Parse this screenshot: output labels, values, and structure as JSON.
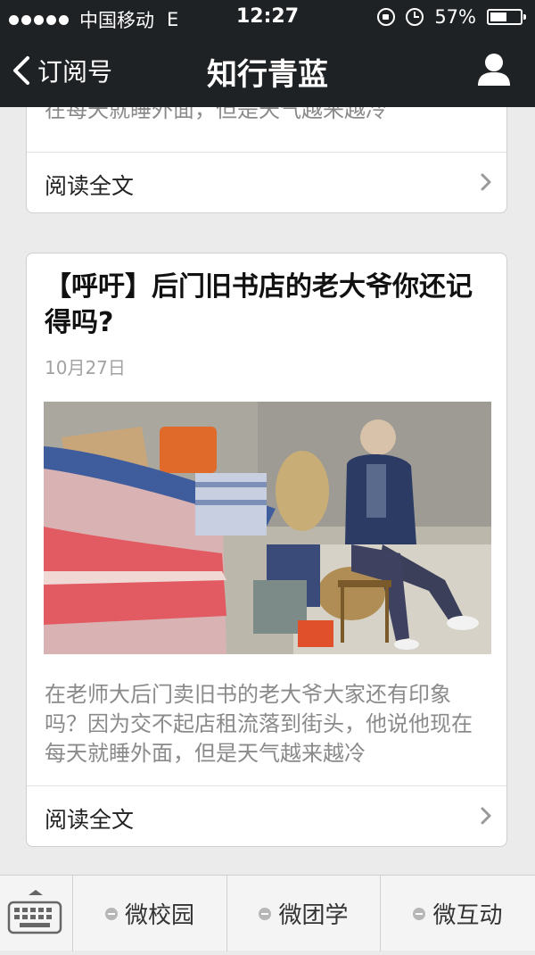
{
  "status": {
    "carrier": "中国移动",
    "network": "E",
    "time": "12:27",
    "battery": "57%",
    "battery_level": 0.57
  },
  "nav": {
    "back_label": "订阅号",
    "title": "知行青蓝"
  },
  "articles": [
    {
      "snippet_tail": "在每天就睡外面，但是天气越来越冷",
      "read_more": "阅读全文"
    },
    {
      "title": "【呼吁】后门旧书店的老大爷你还记得吗?",
      "date": "10月27日",
      "snippet": "在老师大后门卖旧书的老大爷大家还有印象吗？因为交不起店租流落到街头，他说他现在每天就睡外面，但是天气越来越冷",
      "read_more": "阅读全文"
    }
  ],
  "bottom_menu": {
    "items": [
      "微校园",
      "微团学",
      "微互动"
    ]
  },
  "colors": {
    "bar": "#1f2224",
    "background": "#ebebeb",
    "snippet": "#8a8a8a"
  }
}
